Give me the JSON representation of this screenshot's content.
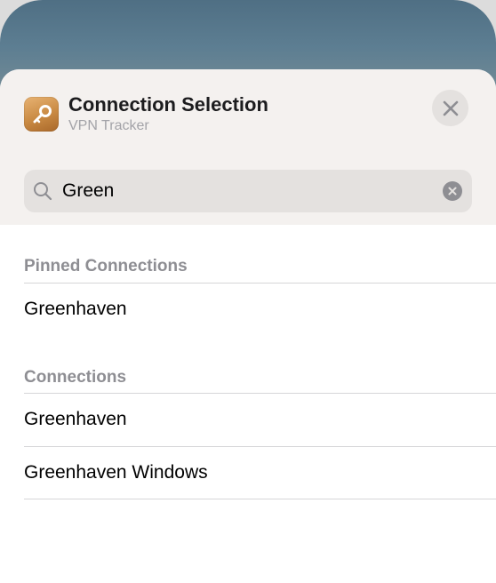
{
  "sheet": {
    "title": "Connection Selection",
    "subtitle": "VPN Tracker",
    "app_icon": "key-icon",
    "close_icon": "close-icon"
  },
  "search": {
    "value": "Green",
    "icon": "search-icon",
    "clear_icon": "clear-icon"
  },
  "pinned": {
    "header": "Pinned Connections",
    "items": [
      {
        "label": "Greenhaven"
      }
    ]
  },
  "connections": {
    "header": "Connections",
    "items": [
      {
        "label": "Greenhaven"
      },
      {
        "label": "Greenhaven Windows"
      }
    ]
  },
  "colors": {
    "header_bg": "#f4f1ef",
    "field_bg": "#e4e1df",
    "section_text": "#8e8e93",
    "app_icon": "#c98a43"
  }
}
